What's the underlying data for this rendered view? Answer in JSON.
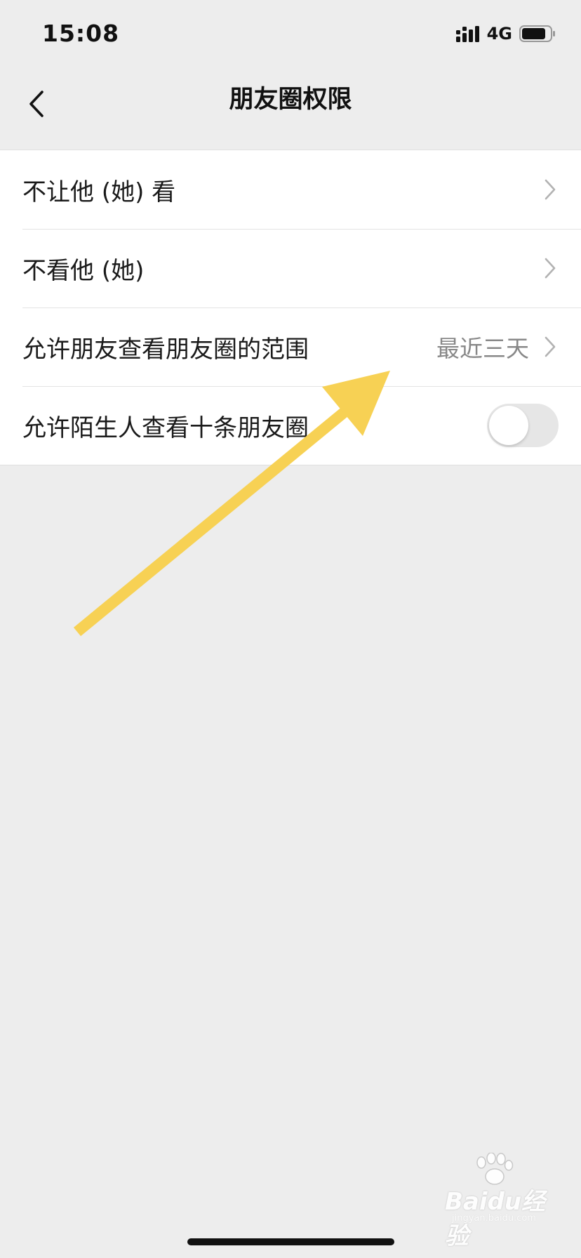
{
  "status_bar": {
    "time": "15:08",
    "network": "4G"
  },
  "nav": {
    "title": "朋友圈权限"
  },
  "settings": {
    "items": [
      {
        "label": "不让他 (她) 看"
      },
      {
        "label": "不看他 (她)"
      },
      {
        "label": "允许朋友查看朋友圈的范围",
        "value": "最近三天"
      },
      {
        "label": "允许陌生人查看十条朋友圈",
        "toggle_on": false
      }
    ]
  },
  "watermark": {
    "logo": "Baidu经验",
    "url": "jingyan.baidu.com"
  },
  "colors": {
    "background": "#ededed",
    "list_background": "#ffffff",
    "annotation_arrow": "#f7d154"
  },
  "icons": {
    "back": "chevron-left-icon",
    "row_disclosure": "chevron-right-icon",
    "signal": "signal-bars-icon",
    "battery": "battery-icon"
  }
}
